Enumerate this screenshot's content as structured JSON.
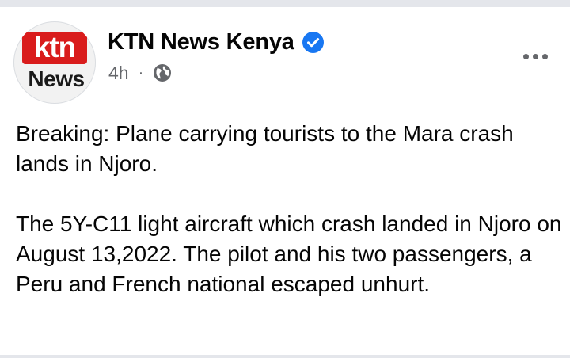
{
  "post": {
    "author": {
      "name": "KTN News Kenya",
      "verified": true,
      "avatar": {
        "top_text": "ktn",
        "bottom_text": "News",
        "brand_color": "#d91c1c"
      }
    },
    "meta": {
      "time": "4h",
      "separator": "·",
      "audience_icon": "globe-icon"
    },
    "more_icon": "more-options-icon",
    "text": {
      "paragraph1": "Breaking: Plane carrying tourists to the Mara crash lands in Njoro.",
      "paragraph2": "The 5Y-C11 light aircraft which crash landed in Njoro on August 13,2022. The pilot and his two passengers, a Peru and French national escaped unhurt."
    }
  },
  "colors": {
    "verified_blue": "#1877f2",
    "secondary_text": "#65676b",
    "divider": "#e4e6eb"
  }
}
